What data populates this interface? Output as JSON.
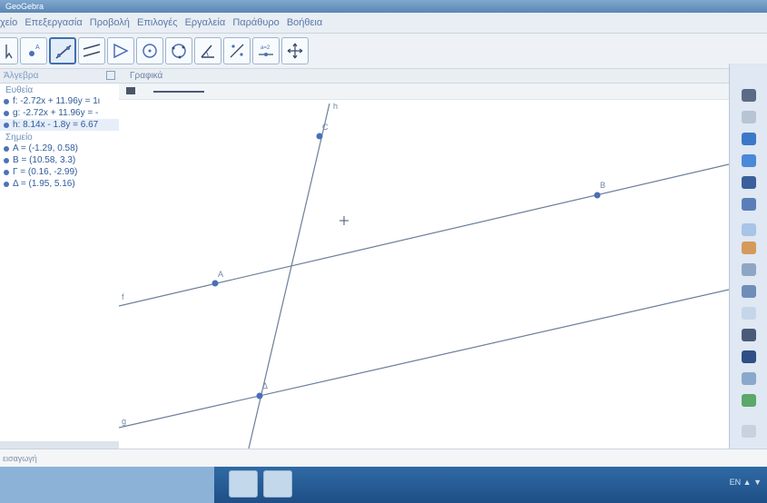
{
  "app": {
    "title": "GeoGebra"
  },
  "menu": [
    "χείο",
    "Επεξεργασία",
    "Προβολή",
    "Επιλογές",
    "Εργαλεία",
    "Παράθυρο",
    "Βοήθεια"
  ],
  "toolbar": {
    "tools": [
      "move-tool",
      "point-tool",
      "line-tool",
      "parallel-line-tool",
      "polygon-tool",
      "circle-tool",
      "circle-three-points-tool",
      "angle-tool",
      "reflect-tool",
      "slider-tool",
      "move-graphics-tool"
    ],
    "active_tool": "line-tool"
  },
  "algebra": {
    "title": "Άλγεβρα",
    "categories": [
      {
        "label": "Ευθεία",
        "items": [
          "f: -2.72x + 11.96y = 1ι",
          "g: -2.72x + 11.96y = -",
          "h: 8.14x - 1.8y = 6.67"
        ]
      },
      {
        "label": "Σημείο",
        "items": [
          "A = (-1.29, 0.58)",
          "B = (10.58, 3.3)",
          "Γ = (0.16, -2.99)",
          "Δ = (1.95, 5.16)"
        ]
      }
    ]
  },
  "graphics": {
    "title": "Γραφικά",
    "labels": {
      "A": "A",
      "B": "B",
      "C": "C",
      "D": "Δ",
      "f": "f",
      "g": "g",
      "h": "h"
    }
  },
  "statusbar": {
    "input_label": "εισαγωγή"
  },
  "taskbar": {
    "tray_text": "EN ▲ ▼"
  },
  "colors": {
    "line": "#6b7f99",
    "point": "#4a6fb8",
    "accent": "#3f6fb0"
  }
}
